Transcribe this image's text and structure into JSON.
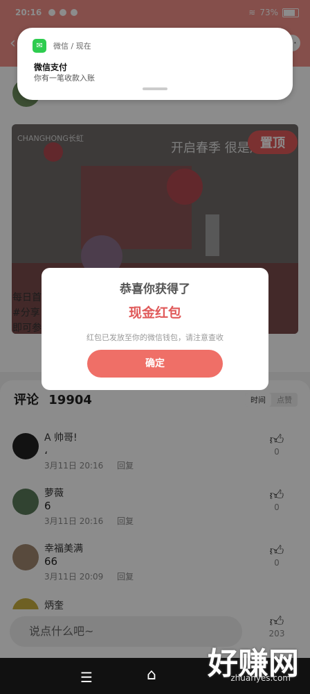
{
  "status_bar": {
    "time": "20:16",
    "battery": "73%",
    "battery_level": 0.73
  },
  "post": {
    "banner_headline": "开启春季 很是风动",
    "banner_brand": "CHANGHONG长虹",
    "pin_label": "置顶",
    "text_lines": [
      "每日首",
      "#分享",
      "即可参"
    ]
  },
  "comments": {
    "header_label": "评论",
    "count": "19904",
    "sort_options": [
      "时间",
      "点赞"
    ],
    "items": [
      {
        "name": "A 帅哥!",
        "text": "،",
        "date": "3月11日",
        "time": "20:16",
        "reply": "回复",
        "likes": "0"
      },
      {
        "name": "萝薇",
        "text": "6",
        "date": "3月11日",
        "time": "20:16",
        "reply": "回复",
        "likes": "0"
      },
      {
        "name": "幸福美满",
        "text": "66",
        "date": "3月11日",
        "time": "20:09",
        "reply": "回复",
        "likes": "0"
      },
      {
        "name": "炳奎",
        "text": "",
        "date": "",
        "time": "",
        "reply": "",
        "likes": ""
      }
    ]
  },
  "input": {
    "placeholder": "说点什么吧~",
    "like_count": "203"
  },
  "notification": {
    "app": "微信 / 现在",
    "title": "微信支付",
    "body": "你有一笔收款入账"
  },
  "modal": {
    "title": "恭喜你获得了",
    "amount": "现金红包",
    "description": "红包已发放至你的微信钱包，请注意查收",
    "confirm_label": "确定"
  },
  "watermark": {
    "text": "好赚网",
    "url": "zhuanyes.com"
  },
  "colors": {
    "accent": "#f39189",
    "button": "#ef6f67",
    "amount": "#e05a5a"
  }
}
